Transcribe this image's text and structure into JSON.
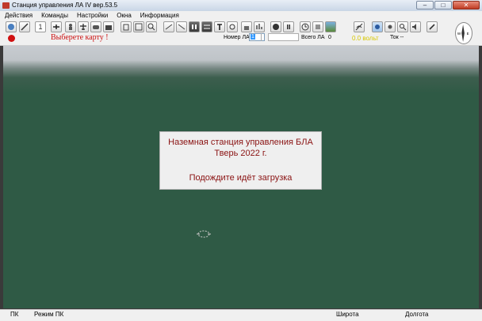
{
  "window": {
    "title": "Станция управления ЛА IV вер.53.5"
  },
  "menu": [
    "Действия",
    "Команды",
    "Настройки",
    "Окна",
    "Информация"
  ],
  "toolbar": {
    "counter_value": "1",
    "map_message": "Выберете карту !",
    "la_number_label": "Номер ЛА",
    "la_number_value": "1",
    "total_la_label": "Всего ЛА",
    "total_la_value": "0",
    "voltage": "0.0 вольт",
    "current_label": "Ток --"
  },
  "splash": {
    "line1": "Наземная станция управления БЛА",
    "line2": "Тверь 2022 г.",
    "line3": "Подождите идёт загрузка"
  },
  "status": {
    "pk": "ПК",
    "mode": "Режим ПК",
    "latitude": "Широта",
    "longitude": "Долгота"
  },
  "colors": {
    "message_red": "#cc1111",
    "splash_text": "#8a1212",
    "ground": "#2f5a45",
    "voltage": "#d8c800"
  }
}
